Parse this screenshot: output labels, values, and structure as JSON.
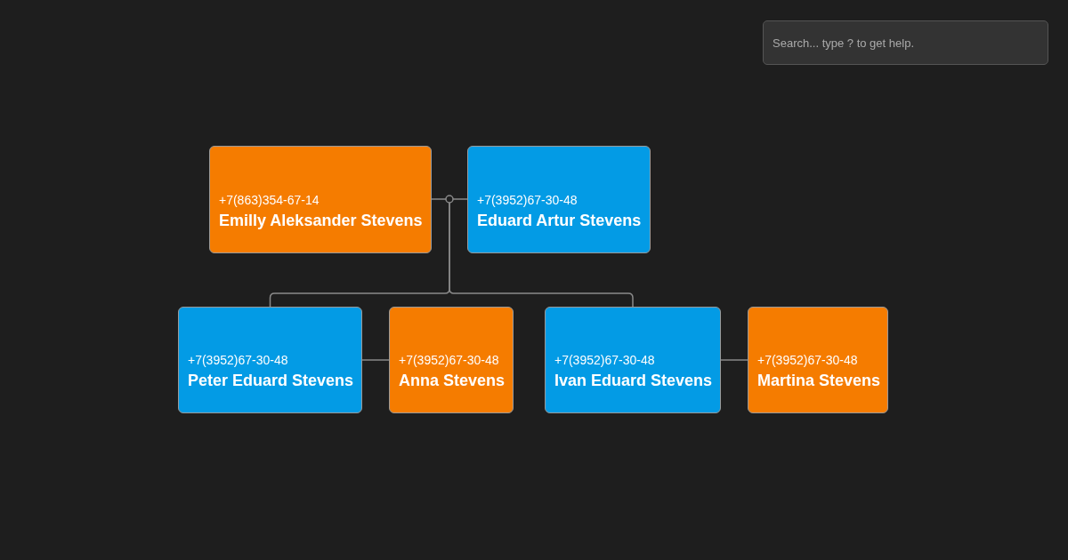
{
  "search": {
    "placeholder": "Search... type ? to get help."
  },
  "tree": {
    "partners": [
      {
        "phone": "+7(863)354-67-14",
        "name": "Emilly Aleksander Stevens",
        "color": "#f57c00"
      },
      {
        "phone": "+7(3952)67-30-48",
        "name": "Eduard Artur Stevens",
        "color": "#039be5"
      }
    ],
    "children": [
      {
        "partners": [
          {
            "phone": "+7(3952)67-30-48",
            "name": "Peter Eduard Stevens",
            "color": "#039be5"
          },
          {
            "phone": "+7(3952)67-30-48",
            "name": "Anna Stevens",
            "color": "#f57c00"
          }
        ]
      },
      {
        "partners": [
          {
            "phone": "+7(3952)67-30-48",
            "name": "Ivan Eduard Stevens",
            "color": "#039be5"
          },
          {
            "phone": "+7(3952)67-30-48",
            "name": "Martina Stevens",
            "color": "#f57c00"
          }
        ]
      }
    ]
  }
}
